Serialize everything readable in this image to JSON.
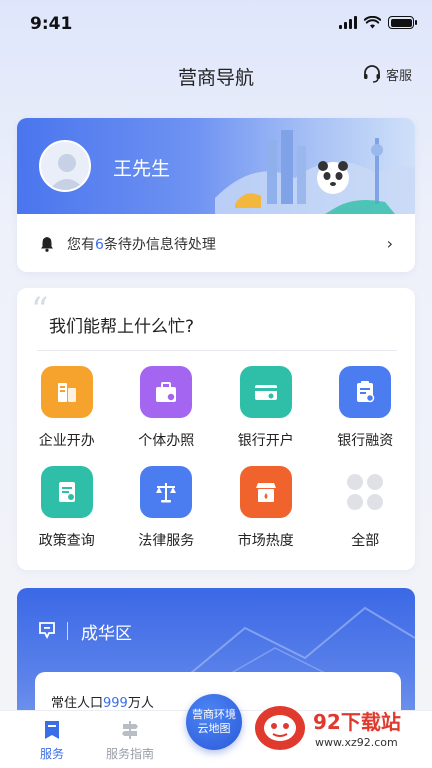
{
  "status_bar": {
    "time": "9:41"
  },
  "header": {
    "title": "营商导航",
    "service_label": "客服"
  },
  "user": {
    "name": "王先生",
    "notice_prefix": "您有",
    "notice_count": "6",
    "notice_suffix": "条待办信息待处理"
  },
  "help": {
    "title": "我们能帮上什么忙?",
    "items": [
      {
        "label": "企业开办",
        "icon": "building-icon",
        "color": "#f5a32c"
      },
      {
        "label": "个体办照",
        "icon": "briefcase-icon",
        "color": "#a466f0"
      },
      {
        "label": "银行开户",
        "icon": "bank-card-icon",
        "color": "#2fbfa8"
      },
      {
        "label": "银行融资",
        "icon": "clipboard-yen-icon",
        "color": "#4c7df0"
      },
      {
        "label": "政策查询",
        "icon": "document-icon",
        "color": "#2fbfa8"
      },
      {
        "label": "法律服务",
        "icon": "scales-icon",
        "color": "#4c7df0"
      },
      {
        "label": "市场热度",
        "icon": "store-flame-icon",
        "color": "#f0632c"
      },
      {
        "label": "全部",
        "icon": "grid-clover-icon",
        "color": "#dfe1e6"
      }
    ]
  },
  "district": {
    "name": "成华区",
    "population_prefix": "常住人口",
    "population_value": "999",
    "population_suffix": "万人"
  },
  "map_button": {
    "line1": "营商环境",
    "line2": "云地图"
  },
  "tabs": [
    {
      "label": "服务",
      "active": true
    },
    {
      "label": "服务指南",
      "active": false
    }
  ],
  "watermark": {
    "title": "92下载站",
    "url": "www.xz92.com"
  },
  "colors": {
    "accent": "#3a6ee8"
  }
}
